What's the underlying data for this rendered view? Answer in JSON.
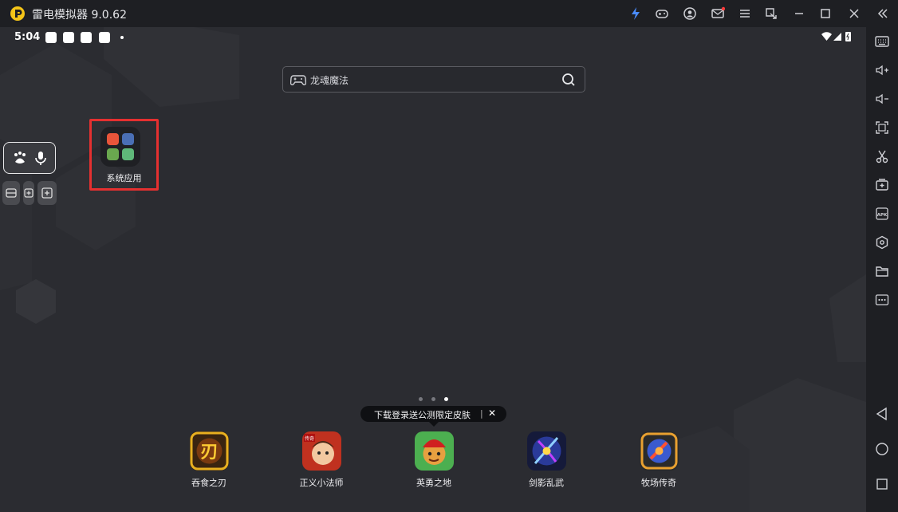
{
  "app": {
    "title": "雷电模拟器 9.0.62"
  },
  "status_bar": {
    "time": "5:04"
  },
  "search": {
    "text": "龙魂魔法"
  },
  "folder": {
    "label": "系统应用"
  },
  "promo": {
    "text": "下载登录送公测限定皮肤",
    "separator": "|",
    "close": "✕"
  },
  "games": [
    {
      "label": "吞食之刃",
      "badge": "刃"
    },
    {
      "label": "正义小法师",
      "badge": "传奇"
    },
    {
      "label": "英勇之地",
      "badge": ""
    },
    {
      "label": "剑影乱武",
      "badge": ""
    },
    {
      "label": "牧场传奇",
      "badge": ""
    }
  ],
  "page_indicator": {
    "count": 3,
    "active": 3
  },
  "colors": {
    "accent": "#e53030",
    "titlebar": "#1e1f23",
    "screen_bg": "#2b2c31",
    "logo": "#f5c518"
  },
  "icons": {
    "titlebar": [
      "lightning-icon",
      "gamepad-icon",
      "user-icon",
      "mail-icon",
      "menu-icon",
      "restore-window-icon",
      "minimize-icon",
      "maximize-icon",
      "close-icon",
      "collapse-icon"
    ],
    "sidebar": [
      "keyboard-icon",
      "volume-up-icon",
      "volume-down-icon",
      "screenshot-icon",
      "scissors-icon",
      "add-screen-icon",
      "apk-icon",
      "settings-hex-icon",
      "folder-icon",
      "more-icon",
      "back-icon",
      "home-icon",
      "recent-apps-icon"
    ]
  }
}
